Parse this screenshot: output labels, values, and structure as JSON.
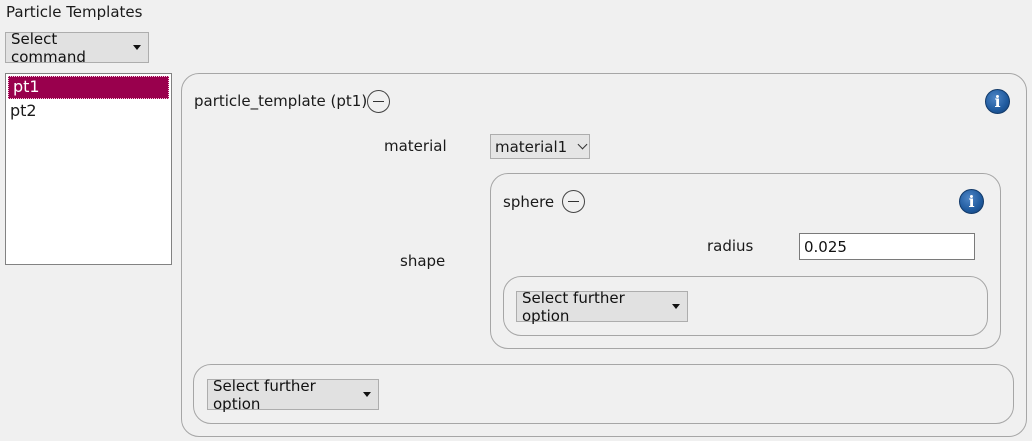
{
  "header": {
    "title": "Particle Templates",
    "select_command_label": "Select command"
  },
  "templates": {
    "items": [
      {
        "label": "pt1",
        "selected": true
      },
      {
        "label": "pt2",
        "selected": false
      }
    ]
  },
  "particle_template": {
    "title": "particle_template (pt1)",
    "material_label": "material",
    "material_value": "material1",
    "shape_label": "shape",
    "shape": {
      "title": "sphere",
      "radius_label": "radius",
      "radius_value": "0.025",
      "further_option_label": "Select further option"
    },
    "further_option_label": "Select further option",
    "info_icon": "i"
  },
  "colors": {
    "selection": "#99004d",
    "info_icon": "#1f5a9e",
    "background": "#f0f0f0"
  }
}
